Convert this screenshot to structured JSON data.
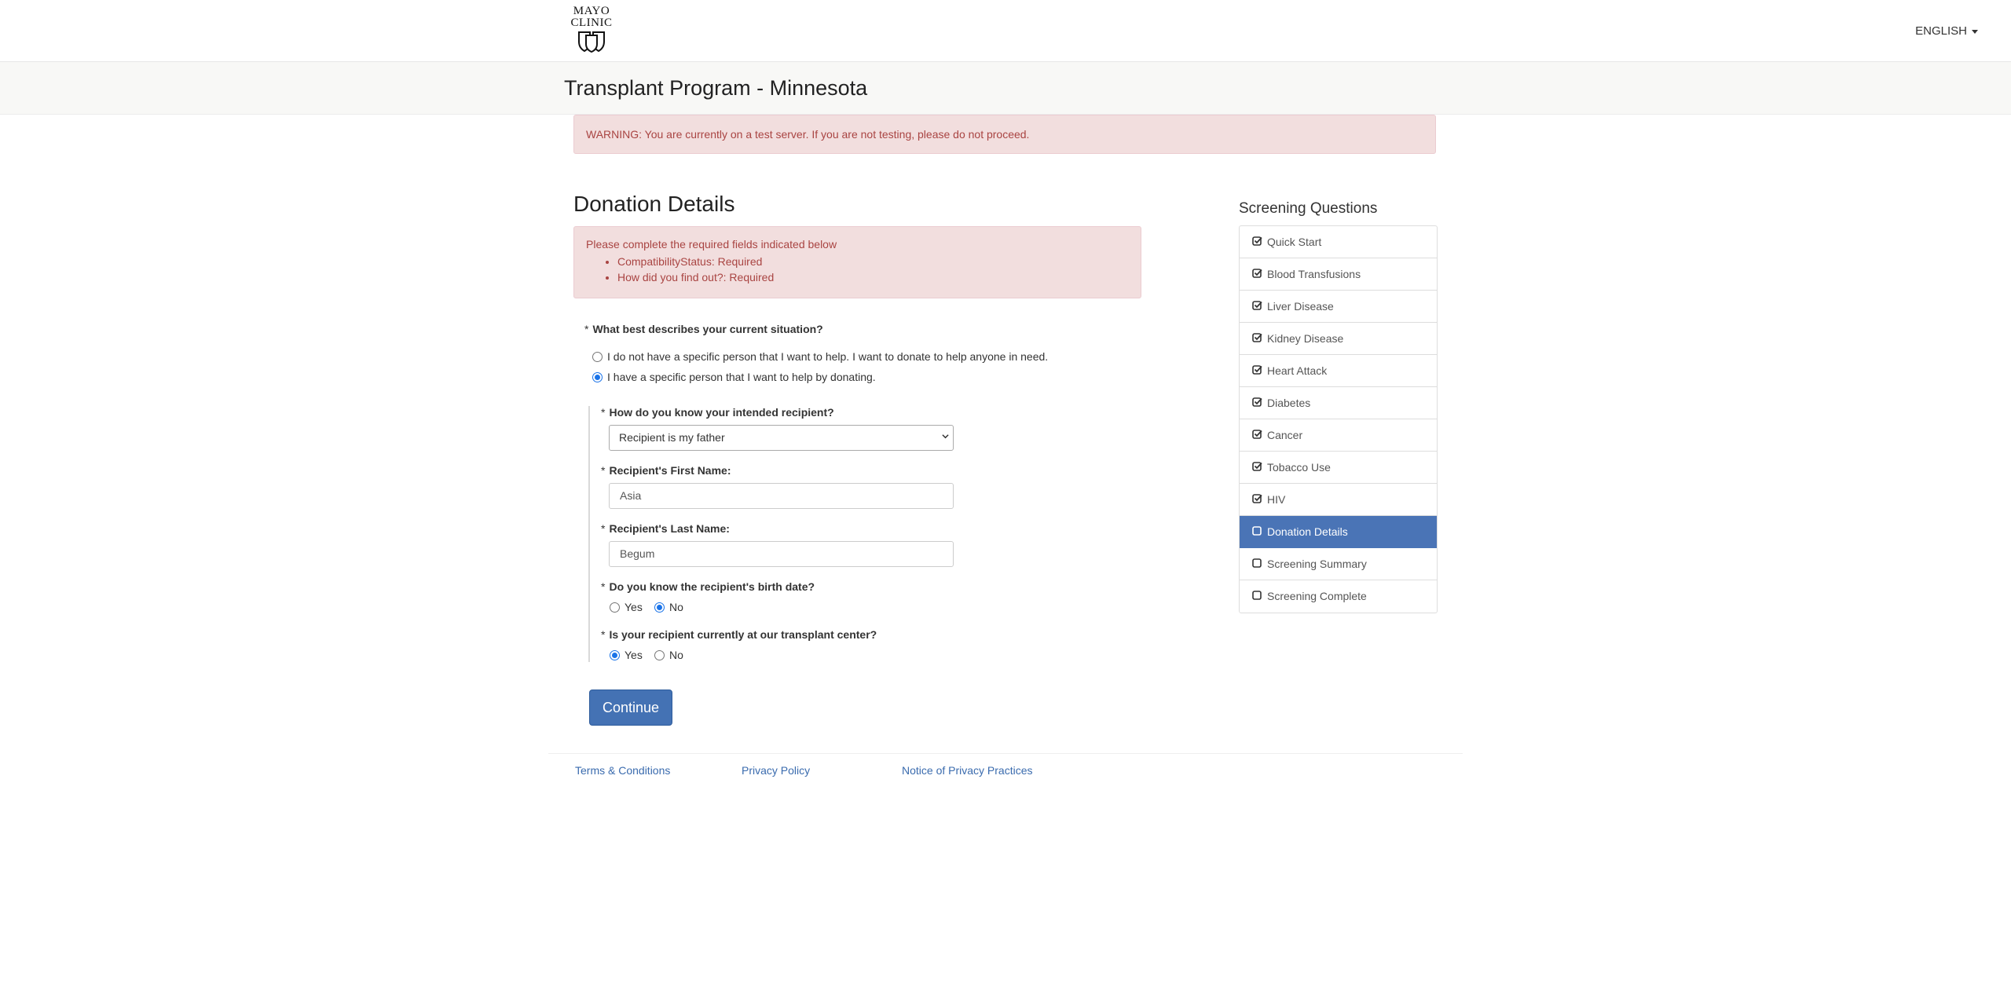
{
  "header": {
    "logo_line1": "MAYO",
    "logo_line2": "CLINIC",
    "language": "ENGLISH"
  },
  "banner": {
    "title": "Transplant Program - Minnesota"
  },
  "warning": "WARNING: You are currently on a test server. If you are not testing, please do not proceed.",
  "page": {
    "heading": "Donation Details"
  },
  "errors": {
    "intro": "Please complete the required fields indicated below",
    "items": [
      "CompatibilityStatus: Required",
      "How did you find out?: Required"
    ]
  },
  "form": {
    "situation": {
      "required_mark": "*",
      "question": "What best describes your current situation?",
      "option_anyone": "I do not have a specific person that I want to help. I want to donate to help anyone in need.",
      "option_specific": "I have a specific person that I want to help by donating.",
      "selected": "specific"
    },
    "relation": {
      "required_mark": "*",
      "question": "How do you know your intended recipient?",
      "value": "Recipient is my father"
    },
    "first_name": {
      "required_mark": "*",
      "label": "Recipient's First Name:",
      "value": "Asia"
    },
    "last_name": {
      "required_mark": "*",
      "label": "Recipient's Last Name:",
      "value": "Begum"
    },
    "birth_date": {
      "required_mark": "*",
      "question": "Do you know the recipient's birth date?",
      "yes": "Yes",
      "no": "No",
      "selected": "no"
    },
    "at_center": {
      "required_mark": "*",
      "question": "Is your recipient currently at our transplant center?",
      "yes": "Yes",
      "no": "No",
      "selected": "yes"
    },
    "continue_label": "Continue"
  },
  "sidebar": {
    "title": "Screening Questions",
    "items": [
      {
        "label": "Quick Start",
        "checked": true
      },
      {
        "label": "Blood Transfusions",
        "checked": true
      },
      {
        "label": "Liver Disease",
        "checked": true
      },
      {
        "label": "Kidney Disease",
        "checked": true
      },
      {
        "label": "Heart Attack",
        "checked": true
      },
      {
        "label": "Diabetes",
        "checked": true
      },
      {
        "label": "Cancer",
        "checked": true
      },
      {
        "label": "Tobacco Use",
        "checked": true
      },
      {
        "label": "HIV",
        "checked": true
      },
      {
        "label": "Donation Details",
        "checked": false,
        "active": true
      },
      {
        "label": "Screening Summary",
        "checked": false
      },
      {
        "label": "Screening Complete",
        "checked": false
      }
    ],
    "active_color": "#4a74b6"
  },
  "footer": {
    "terms": "Terms & Conditions",
    "privacy": "Privacy Policy",
    "notice": "Notice of Privacy Practices"
  }
}
